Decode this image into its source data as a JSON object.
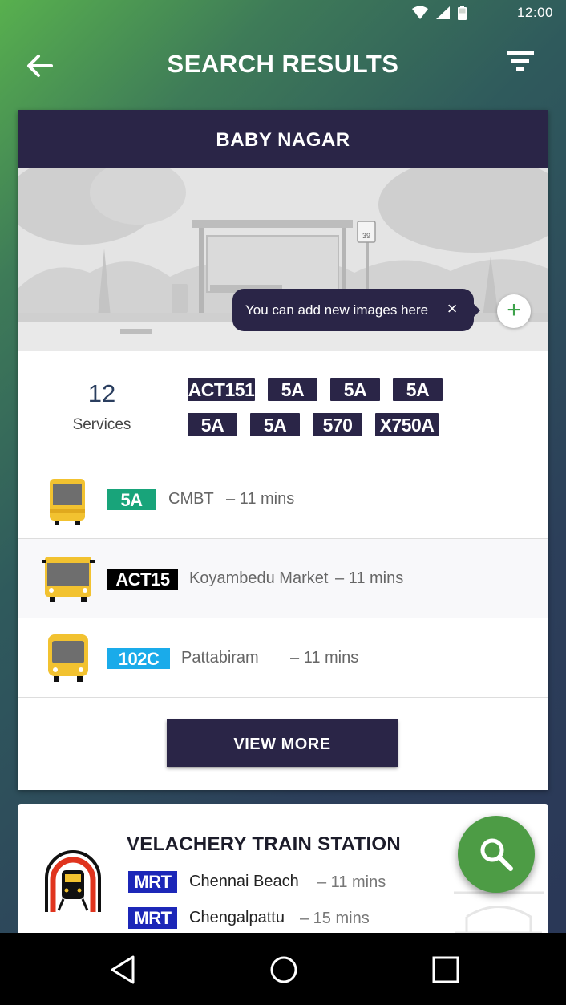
{
  "status_bar": {
    "time": "12:00"
  },
  "header": {
    "title": "SEARCH RESULTS"
  },
  "stop_card": {
    "name": "BABY NAGAR",
    "illustration_sign": "39",
    "tooltip": {
      "text": "You can add new images here",
      "close": "×"
    },
    "add_image": "+",
    "services_count": "12",
    "services_label": "Services",
    "routes": [
      "ACT151",
      "5A",
      "5A",
      "5A",
      "5A",
      "5A",
      "570",
      "X750A"
    ],
    "arrivals": [
      {
        "route": "5A",
        "destination": "CMBT",
        "eta": "– 11 mins",
        "chip_color": "#18a47a",
        "text_color": "#ffffff"
      },
      {
        "route": "ACT15",
        "destination": "Koyambedu Market",
        "eta": "– 11 mins",
        "chip_color": "#000000",
        "text_color": "#ffffff"
      },
      {
        "route": "102C",
        "destination": "Pattabiram",
        "eta": "– 11 mins",
        "chip_color": "#1aabea",
        "text_color": "#ffffff"
      }
    ],
    "view_more": "VIEW MORE"
  },
  "station_card": {
    "name": "VELACHERY TRAIN STATION",
    "trains": [
      {
        "line": "MRT",
        "destination": "Chennai Beach",
        "eta": "– 11 mins"
      },
      {
        "line": "MRT",
        "destination": "Chengalpattu",
        "eta": "– 15 mins"
      }
    ]
  },
  "icons": {
    "back": "arrow-left-icon",
    "filter": "filter-icon",
    "search": "search-icon",
    "bus": "bus-icon",
    "train": "train-icon"
  },
  "colors": {
    "primary_dark": "#2a2547",
    "fab_green": "#4d9c45",
    "mrt_blue": "#1c27b8",
    "bus_yellow": "#f2c230"
  }
}
